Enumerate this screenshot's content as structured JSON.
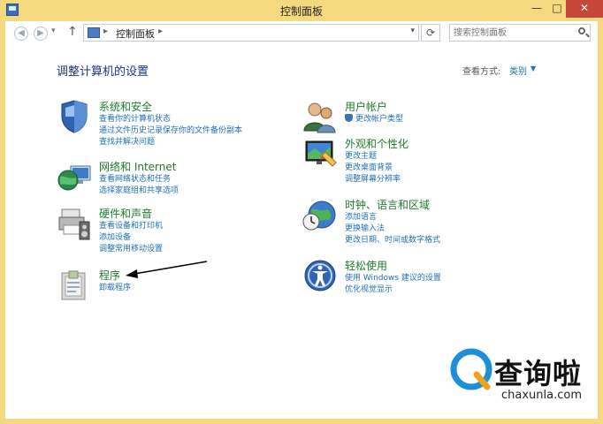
{
  "window": {
    "title": "控制面板",
    "buttons": {
      "minimize": "—",
      "maximize": "□",
      "close": "✕"
    }
  },
  "address": {
    "path_root_sep": "▸",
    "path": "控制面板",
    "path_sep": "▸",
    "dropdown": "▾",
    "refresh": "⟳",
    "search_placeholder": "搜索控制面板"
  },
  "main": {
    "heading": "调整计算机的设置",
    "view_by_label": "查看方式:",
    "view_by_value": "类别",
    "view_by_arrow": "▼"
  },
  "categories_left": [
    {
      "title": "系统和安全",
      "icon": "shield-icon",
      "links": [
        "查看你的计算机状态",
        "通过文件历史记录保存你的文件备份副本",
        "查找并解决问题"
      ]
    },
    {
      "title": "网络和 Internet",
      "icon": "network-globe-icon",
      "links": [
        "查看网络状态和任务",
        "选择家庭组和共享选项"
      ]
    },
    {
      "title": "硬件和声音",
      "icon": "printer-speaker-icon",
      "links": [
        "查看设备和打印机",
        "添加设备",
        "调整常用移动设置"
      ]
    },
    {
      "title": "程序",
      "icon": "programs-icon",
      "links": [
        "卸载程序"
      ]
    }
  ],
  "categories_right": [
    {
      "title": "用户帐户",
      "icon": "users-icon",
      "links": [
        "更改帐户类型"
      ]
    },
    {
      "title": "外观和个性化",
      "icon": "appearance-icon",
      "links": [
        "更改主题",
        "更改桌面背景",
        "调整屏幕分辨率"
      ]
    },
    {
      "title": "时钟、语言和区域",
      "icon": "clock-globe-icon",
      "links": [
        "添加语言",
        "更换输入法",
        "更改日期、时间或数字格式"
      ]
    },
    {
      "title": "轻松使用",
      "icon": "ease-of-access-icon",
      "links": [
        "使用 Windows 建议的设置",
        "优化视觉显示"
      ]
    }
  ],
  "watermark": {
    "brand": "查询啦",
    "site": "chaxunla.com"
  }
}
